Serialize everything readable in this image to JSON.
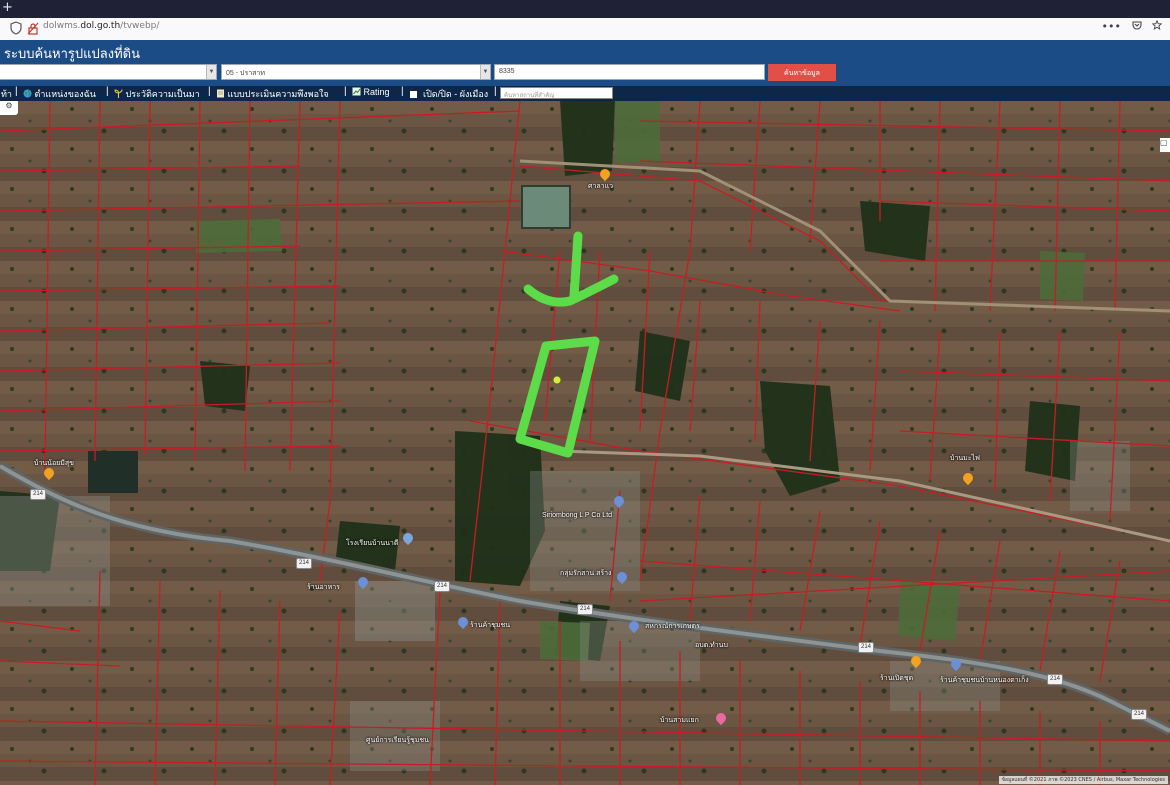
{
  "browser": {
    "new_tab_glyph": "+",
    "url_prefix": "dolwms.",
    "url_domain": "dol.go.th",
    "url_path": "/tvwebp/",
    "menu_glyph": "•••",
    "icons": [
      "shield-icon",
      "lock-icon",
      "pocket-icon",
      "star-icon"
    ]
  },
  "app": {
    "title": "ระบบค้นหารูปแปลงที่ดิน",
    "province_select": "",
    "district_select": "05 - ปราสาท",
    "parcel_number": "8335",
    "search_button": "ค้นหาข้อมูล"
  },
  "toolbar": {
    "home": "ท้า",
    "my_location": "ตำแหน่งของฉัน",
    "history": "ประวัติความเป็นมา",
    "survey": "แบบประเมินความพึงพอใจ",
    "rating": "Rating",
    "toggle_city_plan": "เปิด/ปิด - ผังเมือง",
    "search_place_placeholder": "ค้นหาสถานที่สำคัญ"
  },
  "map": {
    "attribution": "ข้อมูลแผนที่ ©2021 ภาพ ©2023 CNES / Airbus, Maxar Technologies",
    "road_number": "214",
    "labels": [
      "ศาลาแว",
      "Siriombong L P Co Ltd",
      "โรงเรียนบ้านนาดี",
      "บ้านน้อยมีสุข",
      "ร้านอาหาร",
      "กลุ่มรักสาน สร้าง",
      "สหกรณ์การเกษตร",
      "อบต.ทำนบ",
      "ร้านค้าชุมชน",
      "บ้านสามแยก",
      "ร้านเปิดชุด",
      "ร้านค้าชุมชนบ้านหนองตาเก็ง",
      "บ้านมะไฟ",
      "ศูนย์การเรียนรู้ชุมชน"
    ],
    "colors": {
      "parcel_line": "#c61d25",
      "annotation": "#5bdc48",
      "header_bg": "#1c4c85",
      "toolbar_bg": "#0e2748",
      "search_btn": "#e24f47"
    }
  }
}
